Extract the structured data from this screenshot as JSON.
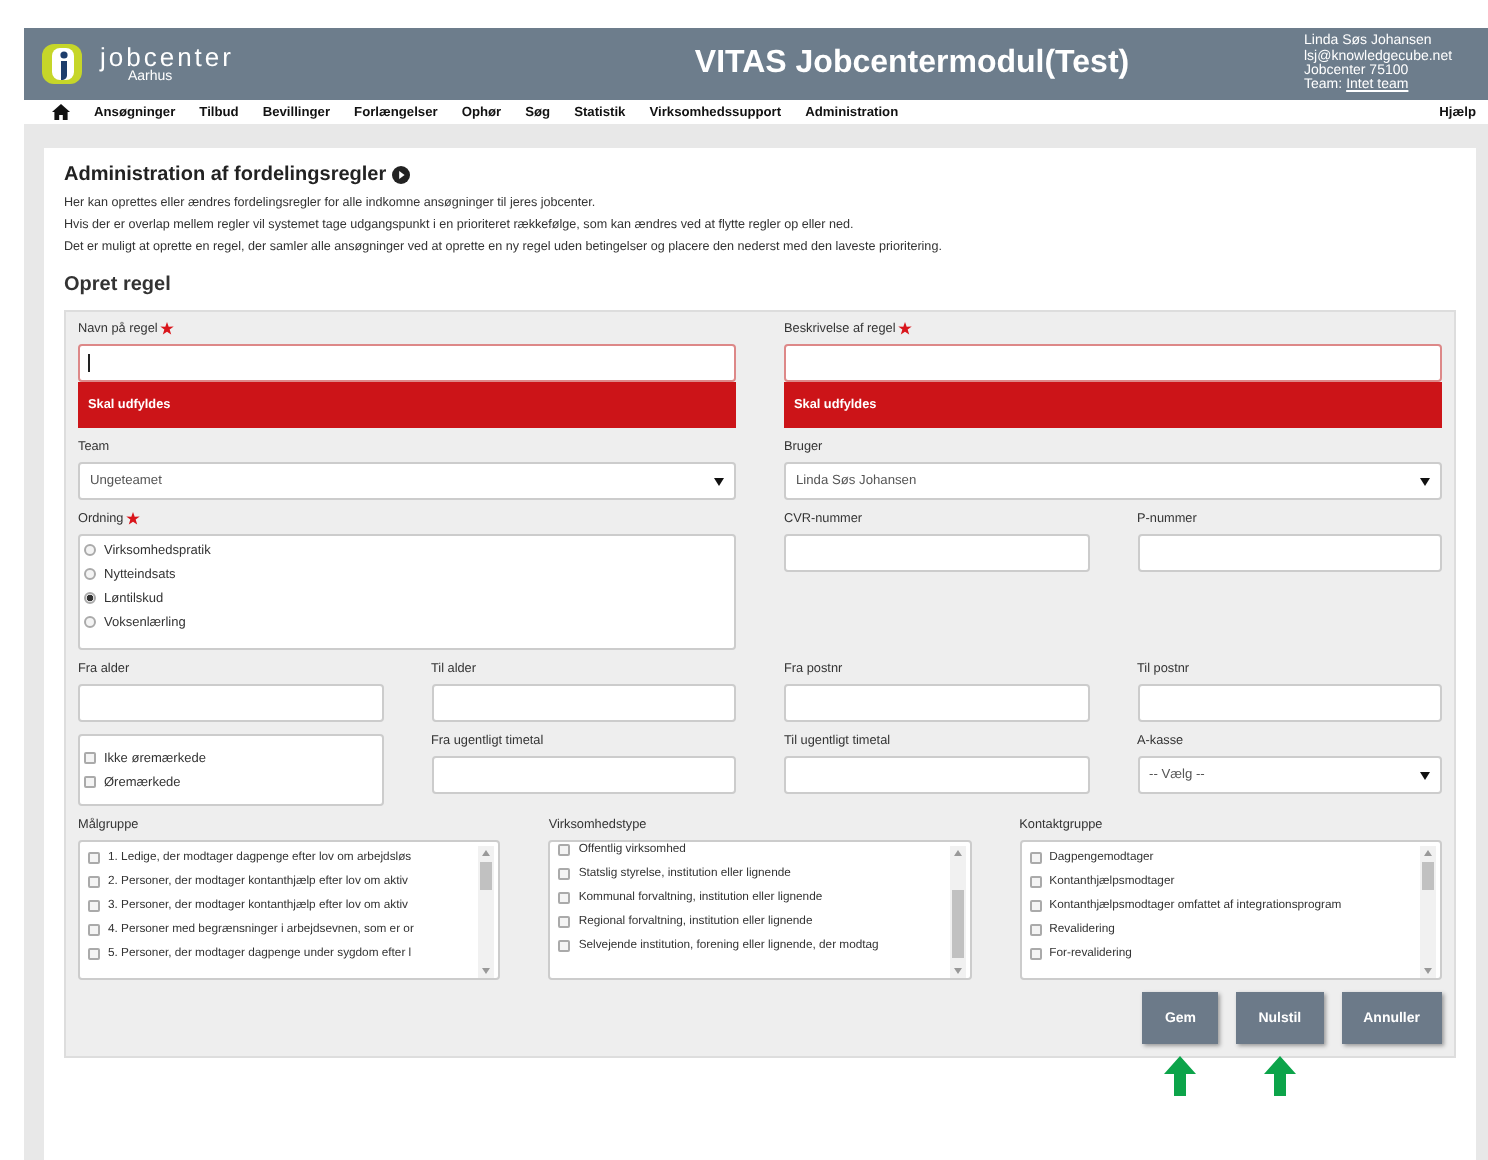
{
  "header": {
    "logo_name": "jobcenter",
    "logo_sub": "Aarhus",
    "title": "VITAS Jobcentermodul(Test)",
    "user": {
      "name": "Linda Søs Johansen",
      "email": "lsj@knowledgecube.net",
      "unit": "Jobcenter 75100",
      "team_label": "Team:",
      "team_link": "Intet team"
    }
  },
  "nav": {
    "items": [
      "Ansøgninger",
      "Tilbud",
      "Bevillinger",
      "Forlængelser",
      "Ophør",
      "Søg",
      "Statistik",
      "Virksomhedssupport",
      "Administration"
    ],
    "help": "Hjælp"
  },
  "page": {
    "heading": "Administration af fordelingsregler",
    "paragraphs": [
      "Her kan oprettes eller ændres fordelingsregler for alle indkomne ansøgninger til jeres jobcenter.",
      "Hvis der er overlap mellem regler vil systemet tage udgangspunkt i en prioriteret rækkefølge, som kan ændres ved at flytte regler op eller ned.",
      "Det er muligt at oprette en regel, der samler alle ansøgninger ved at oprette en ny regel uden betingelser og placere den nederst med den laveste prioritering."
    ],
    "section_title": "Opret regel"
  },
  "form": {
    "rows": [
      [
        {
          "kind": "text",
          "label": "Navn på regel",
          "required": true,
          "focused": true,
          "error": "Skal udfyldes"
        },
        {
          "kind": "text",
          "label": "Beskrivelse af regel",
          "required": true,
          "focused": false,
          "error": "Skal udfyldes"
        }
      ],
      [
        {
          "kind": "select",
          "label": "Team",
          "value": "Ungeteamet"
        },
        {
          "kind": "select",
          "label": "Bruger",
          "value": "Linda Søs Johansen"
        }
      ],
      [
        {
          "kind": "radio",
          "label": "Ordning",
          "required": true,
          "options": [
            {
              "label": "Virksomhedspratik",
              "selected": false
            },
            {
              "label": "Nytteindsats",
              "selected": false
            },
            {
              "label": "Løntilskud",
              "selected": true
            },
            {
              "label": "Voksenlærling",
              "selected": false
            }
          ]
        },
        {
          "kind": "text",
          "label": "CVR-nummer",
          "required": false,
          "focused": false
        },
        {
          "kind": "text",
          "label": "P-nummer",
          "required": false,
          "focused": false
        }
      ],
      [
        {
          "kind": "text",
          "label": "Fra alder",
          "required": false,
          "focused": false
        },
        {
          "kind": "text",
          "label": "Til alder",
          "required": false,
          "focused": false
        },
        {
          "kind": "text",
          "label": "Fra postnr",
          "required": false,
          "focused": false
        },
        {
          "kind": "text",
          "label": "Til postnr",
          "required": false,
          "focused": false
        }
      ],
      [
        {
          "kind": "checks",
          "options": [
            {
              "label": "Ikke øremærkede",
              "checked": false
            },
            {
              "label": "Øremærkede",
              "checked": false
            }
          ]
        },
        {
          "kind": "text",
          "label": "Fra ugentligt timetal",
          "required": false,
          "focused": false
        },
        {
          "kind": "text",
          "label": "Til ugentligt timetal",
          "required": false,
          "focused": false
        },
        {
          "kind": "select",
          "label": "A-kasse",
          "value": "-- Vælg --"
        }
      ],
      [
        {
          "kind": "list",
          "label": "Målgruppe",
          "scrolled": false,
          "options": [
            {
              "label": "1. Ledige, der modtager dagpenge efter lov om arbejdsløs",
              "checked": false
            },
            {
              "label": "2. Personer, der modtager kontanthjælp efter lov om aktiv",
              "checked": false
            },
            {
              "label": "3. Personer, der modtager kontanthjælp efter lov om aktiv",
              "checked": false
            },
            {
              "label": "4. Personer med begrænsninger i arbejdsevnen, som er or",
              "checked": false
            },
            {
              "label": "5. Personer, der modtager dagpenge under sygdom efter l",
              "checked": false
            }
          ]
        },
        {
          "kind": "list",
          "label": "Virksomhedstype",
          "scrolled": true,
          "options": [
            {
              "label": "Offentlig virksomhed",
              "checked": false
            },
            {
              "label": "Statslig styrelse, institution eller lignende",
              "checked": false
            },
            {
              "label": "Kommunal forvaltning, institution eller lignende",
              "checked": false
            },
            {
              "label": "Regional forvaltning, institution eller lignende",
              "checked": false
            },
            {
              "label": "Selvejende institution, forening eller lignende, der modtag",
              "checked": false
            }
          ]
        },
        {
          "kind": "list",
          "label": "Kontaktgruppe",
          "scrolled": false,
          "options": [
            {
              "label": "Dagpengemodtager",
              "checked": false
            },
            {
              "label": "Kontanthjælpsmodtager",
              "checked": false
            },
            {
              "label": "Kontanthjælpsmodtager omfattet af integrationsprogram",
              "checked": false
            },
            {
              "label": "Revalidering",
              "checked": false
            },
            {
              "label": "For-revalidering",
              "checked": false
            }
          ]
        }
      ]
    ],
    "buttons": [
      {
        "label": "Gem",
        "marked": true
      },
      {
        "label": "Nulstil",
        "marked": true
      },
      {
        "label": "Annuller",
        "marked": false
      }
    ]
  }
}
